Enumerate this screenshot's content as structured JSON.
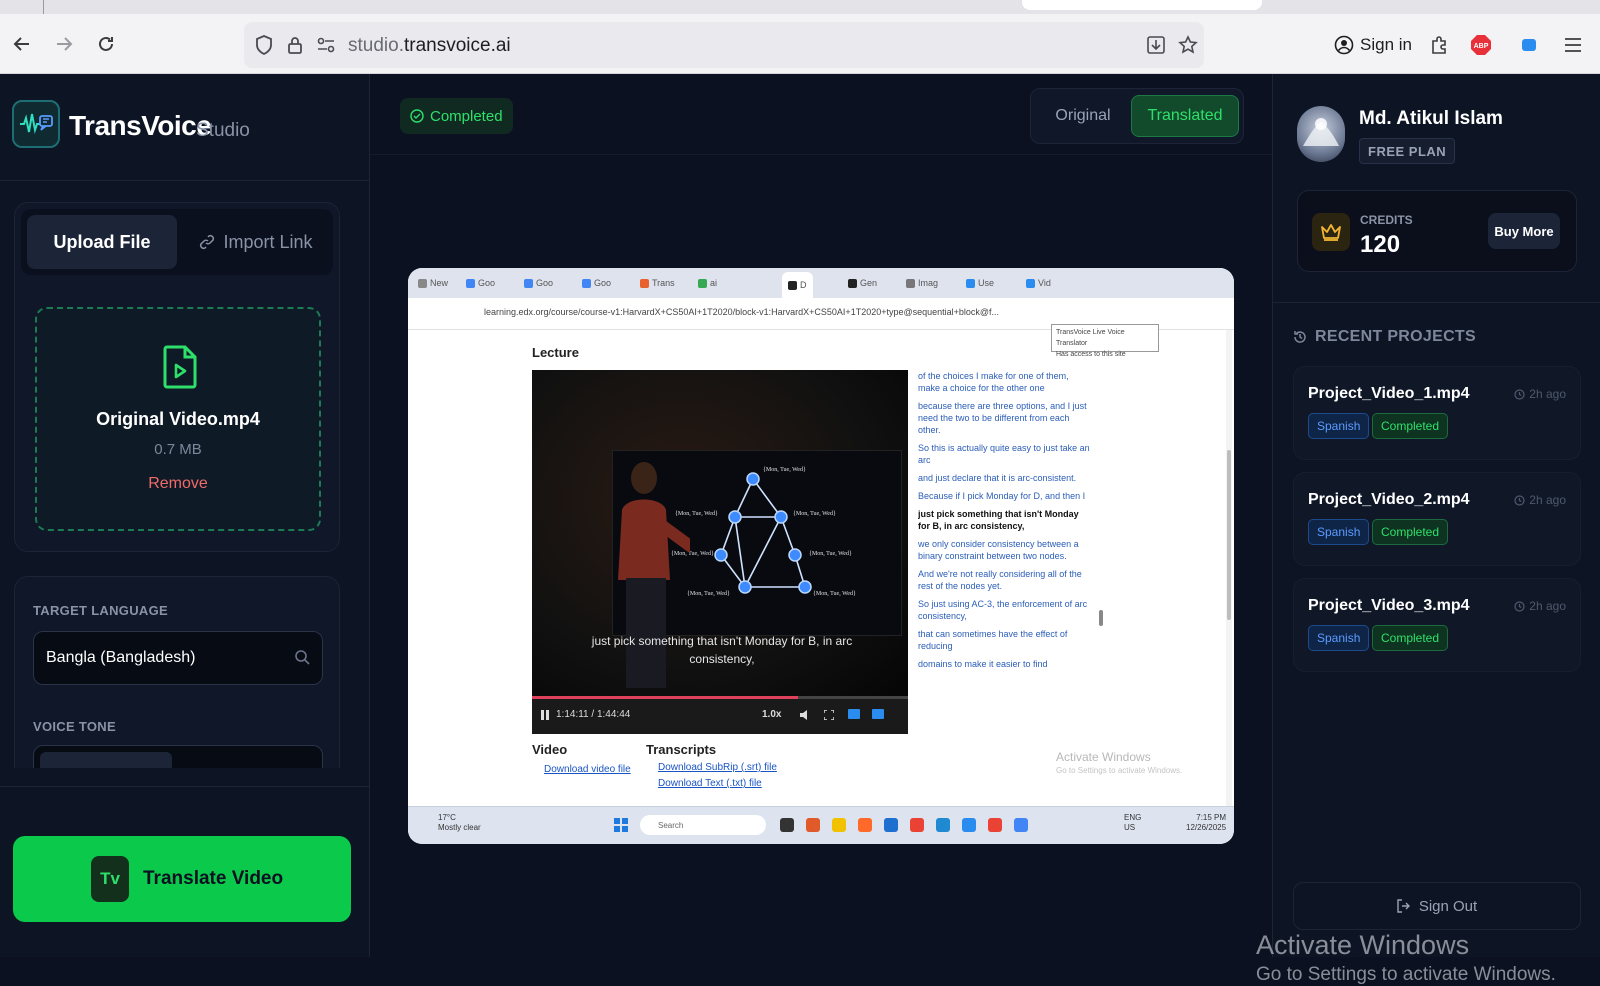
{
  "browser": {
    "url_domain": "studio.",
    "url_rest": "transvoice.ai",
    "sign_in_label": "Sign in"
  },
  "brand": {
    "name": "TransVoice",
    "suffix": "Studio"
  },
  "upload": {
    "tabs": [
      "Upload File",
      "Import Link"
    ],
    "file_name": "Original Video.mp4",
    "file_size": "0.7 MB",
    "remove_label": "Remove"
  },
  "settings": {
    "target_language_label": "TARGET LANGUAGE",
    "target_language_value": "Bangla (Bangladesh)",
    "voice_tone_label": "VOICE TONE"
  },
  "translate_button": {
    "badge": "Tv",
    "label": "Translate Video"
  },
  "status": {
    "label": "Completed"
  },
  "view_toggle": {
    "original": "Original",
    "translated": "Translated",
    "selected": "Translated"
  },
  "video": {
    "inner_url": "learning.edx.org/course/course-v1:HarvardX+CS50AI+1T2020/block-v1:HarvardX+CS50AI+1T2020+type@sequential+block@f...",
    "tooltip_line1": "TransVoice Live Voice Translator",
    "tooltip_line2": "Has access to this site",
    "lecture_label": "Lecture",
    "caption": "just pick something that isn't Monday for B, in arc consistency,",
    "time": "1:14:11 / 1:44:44",
    "rate": "1.0x",
    "progress": 0.708,
    "graph_node_label": "{Mon, Tue, Wed}",
    "transcript": [
      {
        "text": "of the choices I make for one of them, make a choice for the other one",
        "bold": false
      },
      {
        "text": "because there are three options, and I just need the two to be different from each other.",
        "bold": false
      },
      {
        "text": "So this is actually quite easy to just take an arc",
        "bold": false
      },
      {
        "text": "and just declare that it is arc-consistent.",
        "bold": false
      },
      {
        "text": "Because if I pick Monday for D, and then I",
        "bold": false
      },
      {
        "text": "just pick something that isn't Monday for B, in arc consistency,",
        "bold": true
      },
      {
        "text": "we only consider consistency between a binary constraint between two nodes.",
        "bold": false
      },
      {
        "text": "And we're not really considering all of the rest of the nodes yet.",
        "bold": false
      },
      {
        "text": "So just using AC-3, the enforcement of arc consistency,",
        "bold": false
      },
      {
        "text": "that can sometimes have the effect of reducing",
        "bold": false
      },
      {
        "text": "domains to make it easier to find",
        "bold": false
      }
    ],
    "video_section": "Video",
    "download_video": "Download video file",
    "transcripts_section": "Transcripts",
    "download_srt": "Download SubRip (.srt) file",
    "download_txt": "Download Text (.txt) file",
    "watermark_line1": "Activate Windows",
    "watermark_line2": "Go to Settings to activate Windows.",
    "weather_temp": "17°C",
    "weather_desc": "Mostly clear",
    "taskbar_search": "Search",
    "tray_lang1": "ENG",
    "tray_lang2": "US",
    "clock_time": "7:15 PM",
    "clock_date": "12/26/2025"
  },
  "user": {
    "name": "Md. Atikul Islam",
    "plan": "FREE PLAN"
  },
  "credits": {
    "label": "CREDITS",
    "value": "120",
    "buy_label": "Buy More"
  },
  "recent": {
    "heading": "RECENT PROJECTS",
    "projects": [
      {
        "name": "Project_Video_1.mp4",
        "time": "2h ago",
        "language": "Spanish",
        "status": "Completed"
      },
      {
        "name": "Project_Video_2.mp4",
        "time": "2h ago",
        "language": "Spanish",
        "status": "Completed"
      },
      {
        "name": "Project_Video_3.mp4",
        "time": "2h ago",
        "language": "Spanish",
        "status": "Completed"
      }
    ]
  },
  "sign_out_label": "Sign Out",
  "windows_watermark": {
    "line1": "Activate Windows",
    "line2": "Go to Settings to activate Windows."
  },
  "colors": {
    "accent_green": "#0bc94a",
    "background": "#0b1120",
    "panel": "#0d1424",
    "remove_red": "#f06a6a",
    "language_blue": "#5b9bff"
  }
}
